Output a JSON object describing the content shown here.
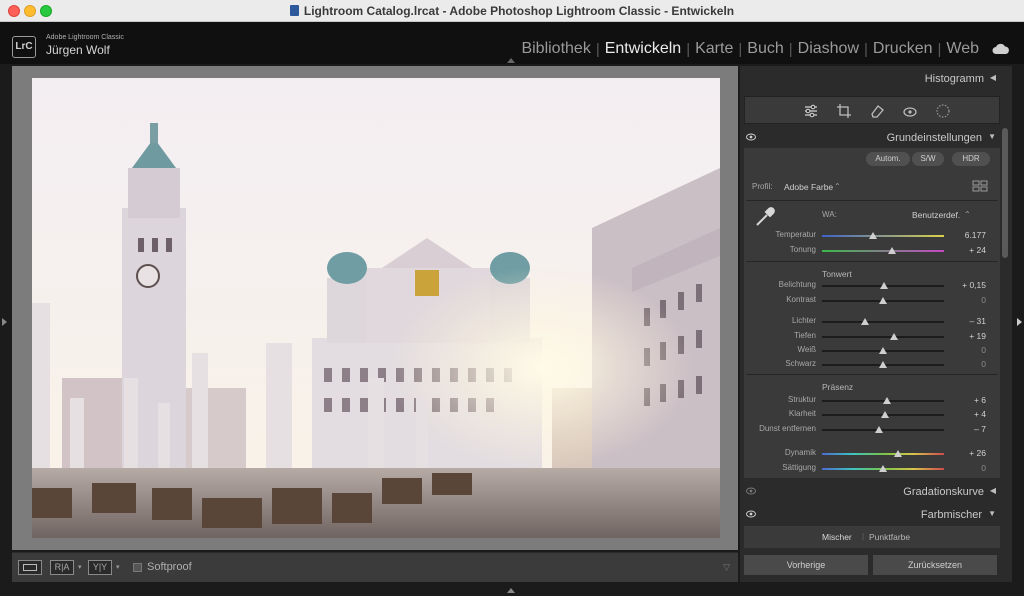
{
  "window": {
    "title": "Lightroom Catalog.lrcat - Adobe Photoshop Lightroom Classic - Entwickeln"
  },
  "identity": {
    "logo": "LrC",
    "app_name": "Adobe Lightroom Classic",
    "user": "Jürgen Wolf"
  },
  "modules": [
    "Bibliothek",
    "Entwickeln",
    "Karte",
    "Buch",
    "Diashow",
    "Drucken",
    "Web"
  ],
  "active_module": "Entwickeln",
  "toolbar": {
    "loupe_label": "",
    "compare_label": "R|A",
    "survey_label": "Y|Y",
    "softproof_label": "Softproof",
    "softproof_checked": false
  },
  "panel": {
    "histogram": "Histogramm",
    "basic": {
      "title": "Grundeinstellungen",
      "auto_label": "Autom.",
      "bw_label": "S/W",
      "hdr_label": "HDR",
      "profile_label": "Profil:",
      "profile_value": "Adobe Farbe",
      "wb_label": "WA:",
      "wb_value": "Benutzerdef.",
      "tone_header": "Tonwert",
      "presence_header": "Präsenz",
      "sliders": [
        {
          "label": "Temperatur",
          "value": "6.177",
          "pos": 0.42,
          "kind": "temp"
        },
        {
          "label": "Tonung",
          "value": "+ 24",
          "pos": 0.57,
          "kind": "tint"
        },
        {
          "label": "Belichtung",
          "value": "+ 0,15",
          "pos": 0.51,
          "kind": "plain"
        },
        {
          "label": "Kontrast",
          "value": "0",
          "pos": 0.5,
          "kind": "plain"
        },
        {
          "label": "Lichter",
          "value": "– 31",
          "pos": 0.35,
          "kind": "plain"
        },
        {
          "label": "Tiefen",
          "value": "+ 19",
          "pos": 0.59,
          "kind": "plain"
        },
        {
          "label": "Weiß",
          "value": "0",
          "pos": 0.5,
          "kind": "plain"
        },
        {
          "label": "Schwarz",
          "value": "0",
          "pos": 0.5,
          "kind": "plain"
        },
        {
          "label": "Struktur",
          "value": "+ 6",
          "pos": 0.53,
          "kind": "plain"
        },
        {
          "label": "Klarheit",
          "value": "+ 4",
          "pos": 0.52,
          "kind": "plain"
        },
        {
          "label": "Dunst entfernen",
          "value": "– 7",
          "pos": 0.47,
          "kind": "plain"
        },
        {
          "label": "Dynamik",
          "value": "+ 26",
          "pos": 0.62,
          "kind": "vib"
        },
        {
          "label": "Sättigung",
          "value": "0",
          "pos": 0.5,
          "kind": "sat"
        }
      ]
    },
    "tone_curve": "Gradationskurve",
    "color_mixer": {
      "title": "Farbmischer",
      "tab_mixer": "Mischer",
      "tab_point": "Punktfarbe"
    },
    "prev_button": "Vorherige",
    "reset_button": "Zurücksetzen"
  },
  "colors": {
    "accent_light": "#ececec",
    "panel_bg": "#2b2b2b",
    "section_bg": "#3a3a3a"
  }
}
